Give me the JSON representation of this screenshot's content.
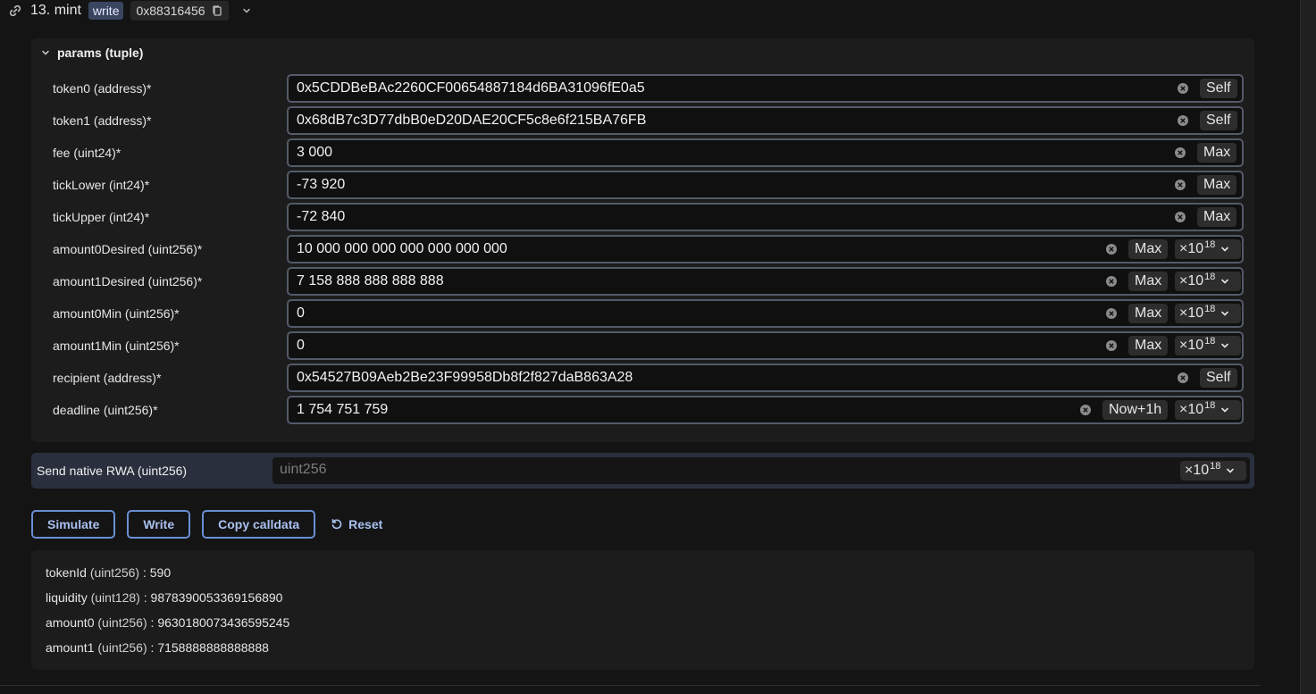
{
  "header": {
    "title": "13. mint",
    "mode_badge": "write",
    "selector": "0x88316456"
  },
  "params": {
    "title": "params (tuple)",
    "fields": [
      {
        "label": "token0 (address)*",
        "value": "0x5CDDBeBAc2260CF00654887184d6BA31096fE0a5",
        "action": "Self"
      },
      {
        "label": "token1 (address)*",
        "value": "0x68dB7c3D77dbB0eD20DAE20CF5c8e6f215BA76FB",
        "action": "Self"
      },
      {
        "label": "fee (uint24)*",
        "value": "3 000",
        "action": "Max"
      },
      {
        "label": "tickLower (int24)*",
        "value": "-73 920",
        "action": "Max"
      },
      {
        "label": "tickUpper (int24)*",
        "value": "-72 840",
        "action": "Max"
      },
      {
        "label": "amount0Desired (uint256)*",
        "value": "10 000 000 000 000 000 000 000",
        "action": "Max",
        "unit_base": "×10",
        "unit_exp": "18"
      },
      {
        "label": "amount1Desired (uint256)*",
        "value": "7 158 888 888 888 888",
        "action": "Max",
        "unit_base": "×10",
        "unit_exp": "18"
      },
      {
        "label": "amount0Min (uint256)*",
        "value": "0",
        "action": "Max",
        "unit_base": "×10",
        "unit_exp": "18"
      },
      {
        "label": "amount1Min (uint256)*",
        "value": "0",
        "action": "Max",
        "unit_base": "×10",
        "unit_exp": "18"
      },
      {
        "label": "recipient (address)*",
        "value": "0x54527B09Aeb2Be23F99958Db8f2f827daB863A28",
        "action": "Self"
      },
      {
        "label": "deadline (uint256)*",
        "value": "1 754 751 759",
        "action": "Now+1h",
        "unit_base": "×10",
        "unit_exp": "18"
      }
    ]
  },
  "native": {
    "label": "Send native RWA (uint256)",
    "placeholder": "uint256",
    "unit_base": "×10",
    "unit_exp": "18"
  },
  "actions": {
    "simulate": "Simulate",
    "write": "Write",
    "copy_calldata": "Copy calldata",
    "reset": "Reset"
  },
  "results": [
    {
      "name": "tokenId",
      "type": "(uint256)",
      "sep": ":",
      "value": "590"
    },
    {
      "name": "liquidity",
      "type": "(uint128)",
      "sep": ":",
      "value": "9878390053369156890"
    },
    {
      "name": "amount0",
      "type": "(uint256)",
      "sep": ":",
      "value": "9630180073436595245"
    },
    {
      "name": "amount1",
      "type": "(uint256)",
      "sep": ":",
      "value": "7158888888888888"
    }
  ],
  "colors": {
    "accent": "#6a8fd4",
    "badge_bg": "#3a4560",
    "input_border": "#545a6a",
    "native_bg": "#2a2f3e"
  },
  "icons": {
    "header_left": "link-icon",
    "selector_copy": "copy-icon",
    "header_expand": "chevron-down-icon",
    "params_collapse": "chevron-down-icon",
    "field_clear": "clear-circle-icon",
    "reset": "reset-arrow-icon"
  }
}
